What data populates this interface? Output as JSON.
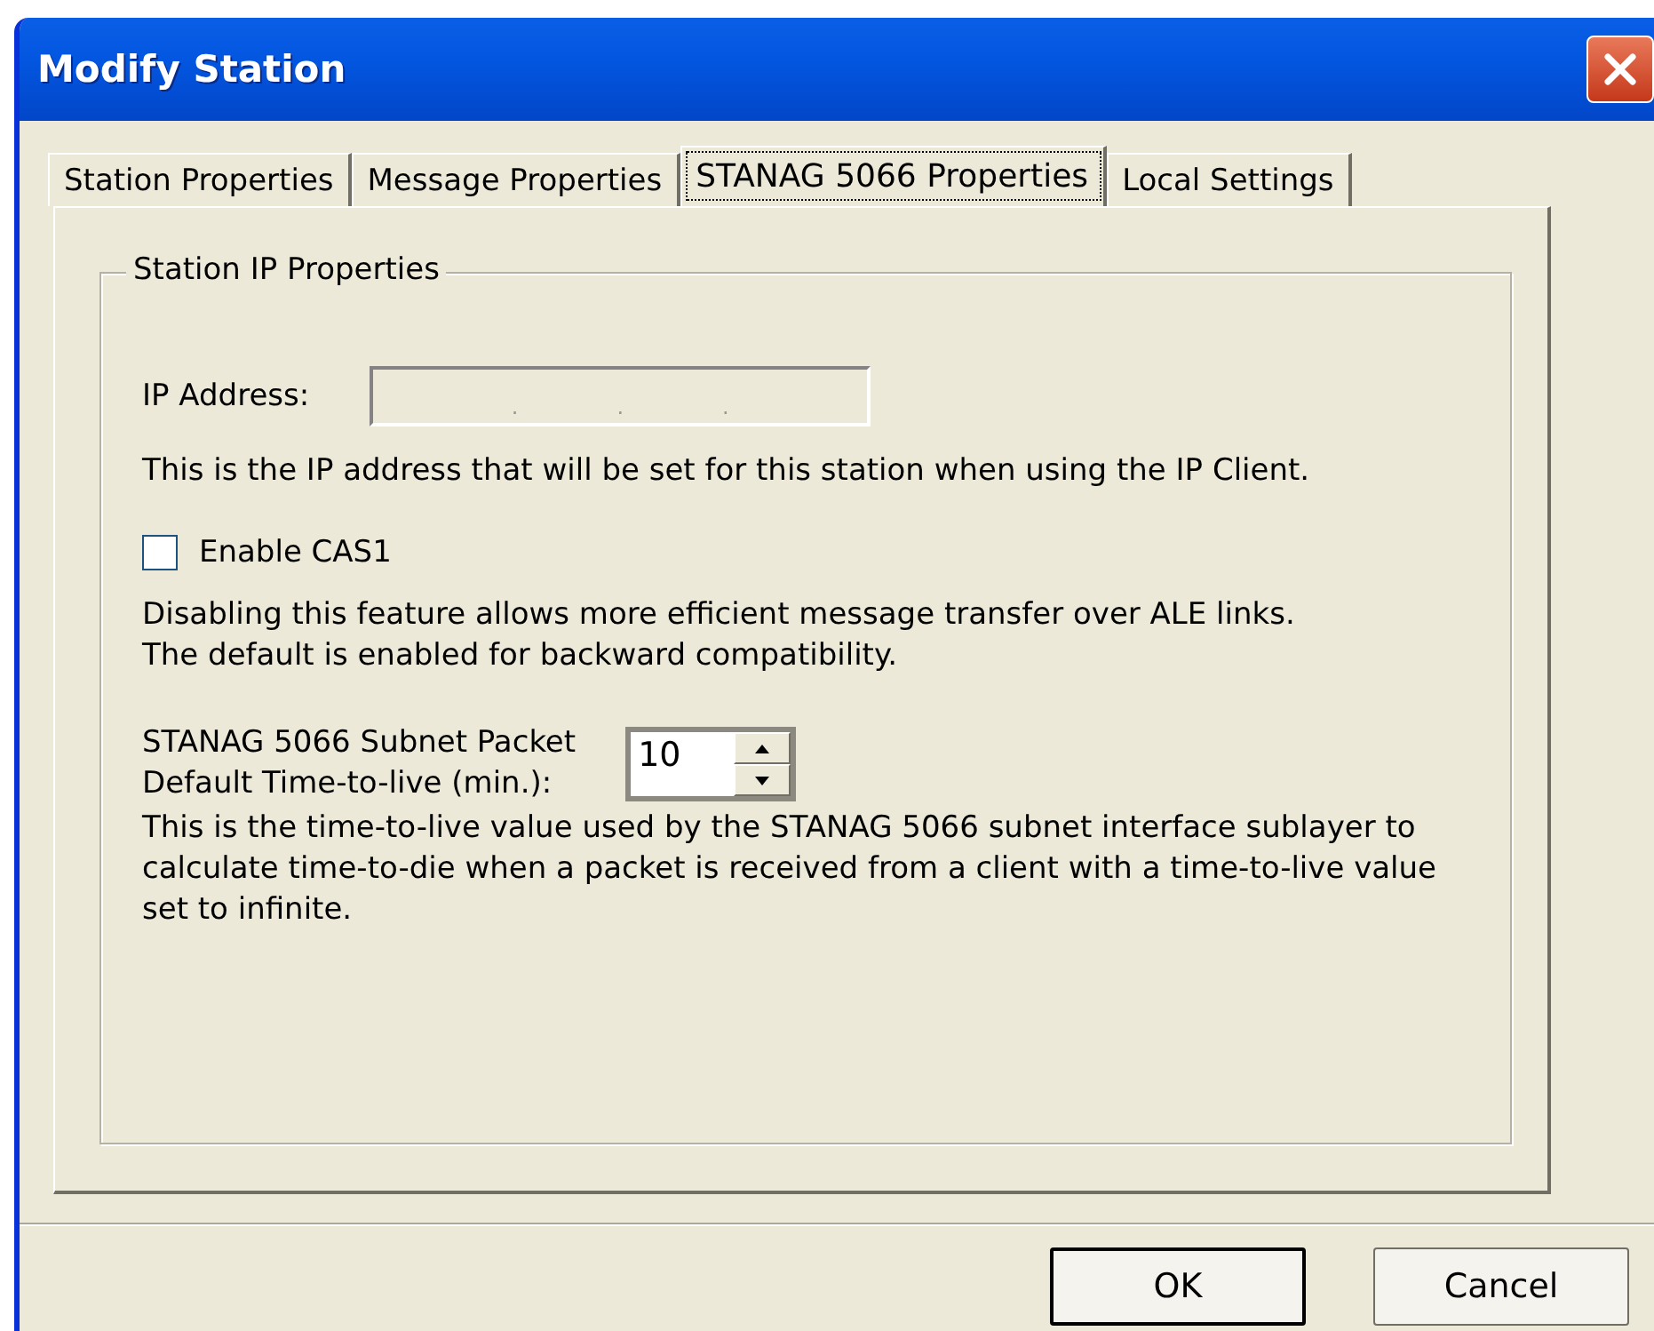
{
  "window": {
    "title": "Modify Station"
  },
  "tabs": [
    {
      "label": "Station Properties",
      "selected": false
    },
    {
      "label": "Message Properties",
      "selected": false
    },
    {
      "label": "STANAG 5066 Properties",
      "selected": true
    },
    {
      "label": "Local Settings",
      "selected": false
    }
  ],
  "group": {
    "title": "Station IP Properties",
    "ip_address": {
      "label": "IP Address:",
      "separators": [
        ".",
        ".",
        "."
      ],
      "disabled": true
    },
    "ip_help": "This is the IP address that will be set for this station when using the IP Client.",
    "cas1": {
      "label": "Enable CAS1",
      "checked": false
    },
    "cas1_help": [
      "Disabling this feature allows more efficient message transfer over ALE links.",
      "The default is enabled for backward compatibility."
    ],
    "ttl": {
      "label": [
        "STANAG 5066 Subnet Packet",
        "Default Time-to-live (min.):"
      ],
      "value": "10"
    },
    "ttl_help": "This is the time-to-live value used by the STANAG 5066 subnet interface sublayer to calculate time-to-die when a packet is received from a client with a time-to-live value set to infinite."
  },
  "buttons": [
    {
      "label": "OK",
      "default": true
    },
    {
      "label": "Cancel",
      "default": false
    }
  ]
}
